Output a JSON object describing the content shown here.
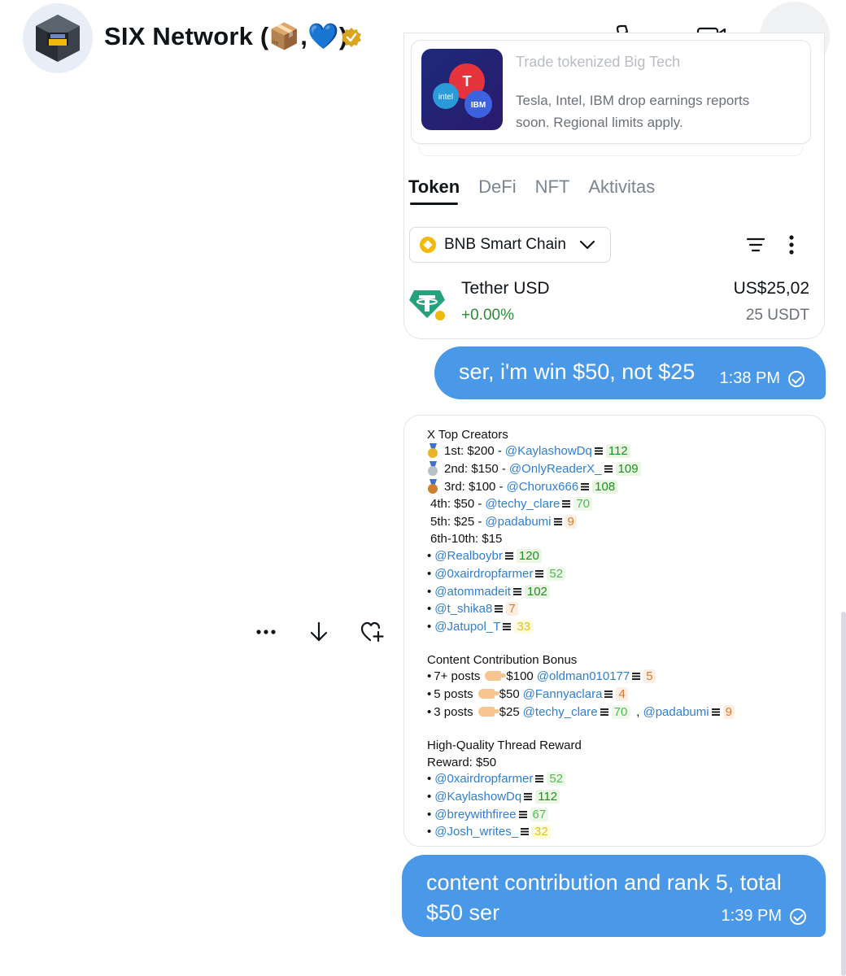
{
  "header": {
    "name": "SIX Network (📦,💙)",
    "icons": [
      "avatar",
      "verified-badge-icon",
      "phone-icon",
      "video-icon",
      "more-icon"
    ]
  },
  "shot": {
    "promo_title": "Trade tokenized Big Tech",
    "promo_text": "Tesla, Intel, IBM drop earnings reports soon. Regional limits apply.",
    "tabs": [
      "Token",
      "DeFi",
      "NFT",
      "Aktivitas"
    ],
    "chain": "BNB Smart Chain",
    "token": {
      "name": "Tether USD",
      "change": "+0.00%",
      "value": "US$25,02",
      "amount": "25 USDT"
    }
  },
  "msg1": {
    "text": "ser, i'm win $50, not $25",
    "time": "1:38 PM"
  },
  "msg2": {
    "text": "content contribution and rank 5, total $50 ser",
    "time": "1:39 PM"
  },
  "board": {
    "title": "X Top Creators",
    "top": [
      {
        "rank": "1st: $200 -",
        "handle": "@KaylashowDq",
        "score": "112"
      },
      {
        "rank": "2nd: $150 -",
        "handle": "@OnlyReaderX_",
        "score": "109"
      },
      {
        "rank": "3rd: $100 -",
        "handle": "@Chorux666",
        "score": "108"
      },
      {
        "rank": "4th: $50 -",
        "handle": "@techy_clare",
        "score": "70"
      },
      {
        "rank": "5th: $25 -",
        "handle": "@padabumi",
        "score": "9"
      }
    ],
    "sixth_label": "6th-10th: $15",
    "sixth": [
      {
        "handle": "@Realboybr",
        "score": "120"
      },
      {
        "handle": "@0xairdropfarmer",
        "score": "52"
      },
      {
        "handle": "@atommadeit",
        "score": "102"
      },
      {
        "handle": "@t_shika8",
        "score": "7"
      },
      {
        "handle": "@Jatupol_T",
        "score": "33"
      }
    ],
    "bonus_title": "Content Contribution Bonus",
    "bonus": [
      {
        "posts": "7+ posts",
        "amount": "$100",
        "handle": "@oldman010177",
        "score": "5"
      },
      {
        "posts": "5 posts",
        "amount": "$50",
        "handle": "@Fannyaclara",
        "score": "4"
      },
      {
        "posts": "3 posts",
        "amount": "$25",
        "handle": "@techy_clare",
        "score": "70",
        "handle2": "@padabumi",
        "score2": "9"
      }
    ],
    "thread_title": "High-Quality Thread Reward",
    "thread_reward": "Reward: $50",
    "thread": [
      {
        "handle": "@0xairdropfarmer",
        "score": "52"
      },
      {
        "handle": "@KaylashowDq",
        "score": "112"
      },
      {
        "handle": "@breywithfiree",
        "score": "67"
      },
      {
        "handle": "@Josh_writes_",
        "score": "32"
      }
    ]
  },
  "hover_actions": [
    "more-icon",
    "download-icon",
    "react-icon"
  ]
}
